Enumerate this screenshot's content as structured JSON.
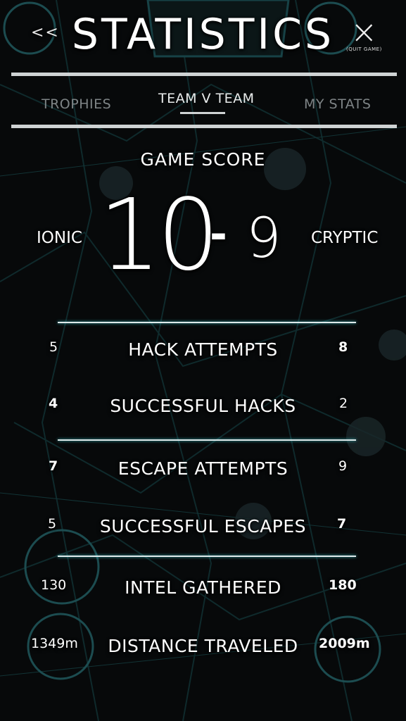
{
  "header": {
    "back_label": "<<",
    "title": "STATISTICS",
    "quit_label": "(QUIT GAME)"
  },
  "tabs": [
    {
      "label": "TROPHIES",
      "active": false
    },
    {
      "label": "TEAM V TEAM",
      "active": true
    },
    {
      "label": "MY STATS",
      "active": false
    }
  ],
  "game_score": {
    "heading": "GAME SCORE",
    "left_team": "IONIC",
    "right_team": "CRYPTIC",
    "left_score": "10",
    "separator": "-",
    "right_score": "9"
  },
  "stats": [
    {
      "label": "HACK ATTEMPTS",
      "left": "5",
      "right": "8",
      "leader": "right"
    },
    {
      "label": "SUCCESSFUL HACKS",
      "left": "4",
      "right": "2",
      "leader": "left"
    },
    {
      "label": "ESCAPE ATTEMPTS",
      "left": "7",
      "right": "9",
      "leader": "left"
    },
    {
      "label": "SUCCESSFUL ESCAPES",
      "left": "5",
      "right": "7",
      "leader": "right"
    },
    {
      "label": "INTEL GATHERED",
      "left": "130",
      "right": "180",
      "leader": "right"
    },
    {
      "label": "DISTANCE TRAVELED",
      "left": "1349m",
      "right": "2009m",
      "leader": "right"
    }
  ],
  "colors": {
    "background": "#07090a",
    "accent_teal": "#39bfc4",
    "text": "#ffffff",
    "tab_inactive": "#7e8486"
  }
}
